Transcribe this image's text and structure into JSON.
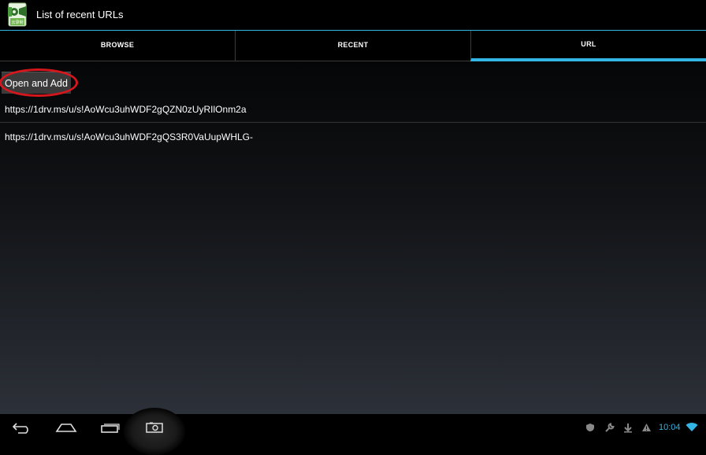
{
  "app": {
    "title": "List of recent URLs",
    "icon": "clapperboard-film-icon"
  },
  "tabs": [
    {
      "label": "BROWSE",
      "selected": false
    },
    {
      "label": "RECENT",
      "selected": false
    },
    {
      "label": "URL",
      "selected": true
    }
  ],
  "actions": {
    "open_and_add_label": "Open and Add"
  },
  "urls": [
    "https://1drv.ms/u/s!AoWcu3uhWDF2gQZN0zUyRIlOnm2a",
    "https://1drv.ms/u/s!AoWcu3uhWDF2gQS3R0VaUupWHLG-"
  ],
  "navbar": {
    "buttons": [
      "back-icon",
      "home-icon",
      "recent-apps-icon",
      "screenshot-camera-icon"
    ]
  },
  "statusbar": {
    "icons": [
      "shield-icon",
      "wrench-icon",
      "download-icon",
      "warning-icon",
      "wifi-icon"
    ],
    "time": "10:04"
  },
  "colors": {
    "accent": "#33b5e5",
    "highlight": "#d4161d"
  }
}
